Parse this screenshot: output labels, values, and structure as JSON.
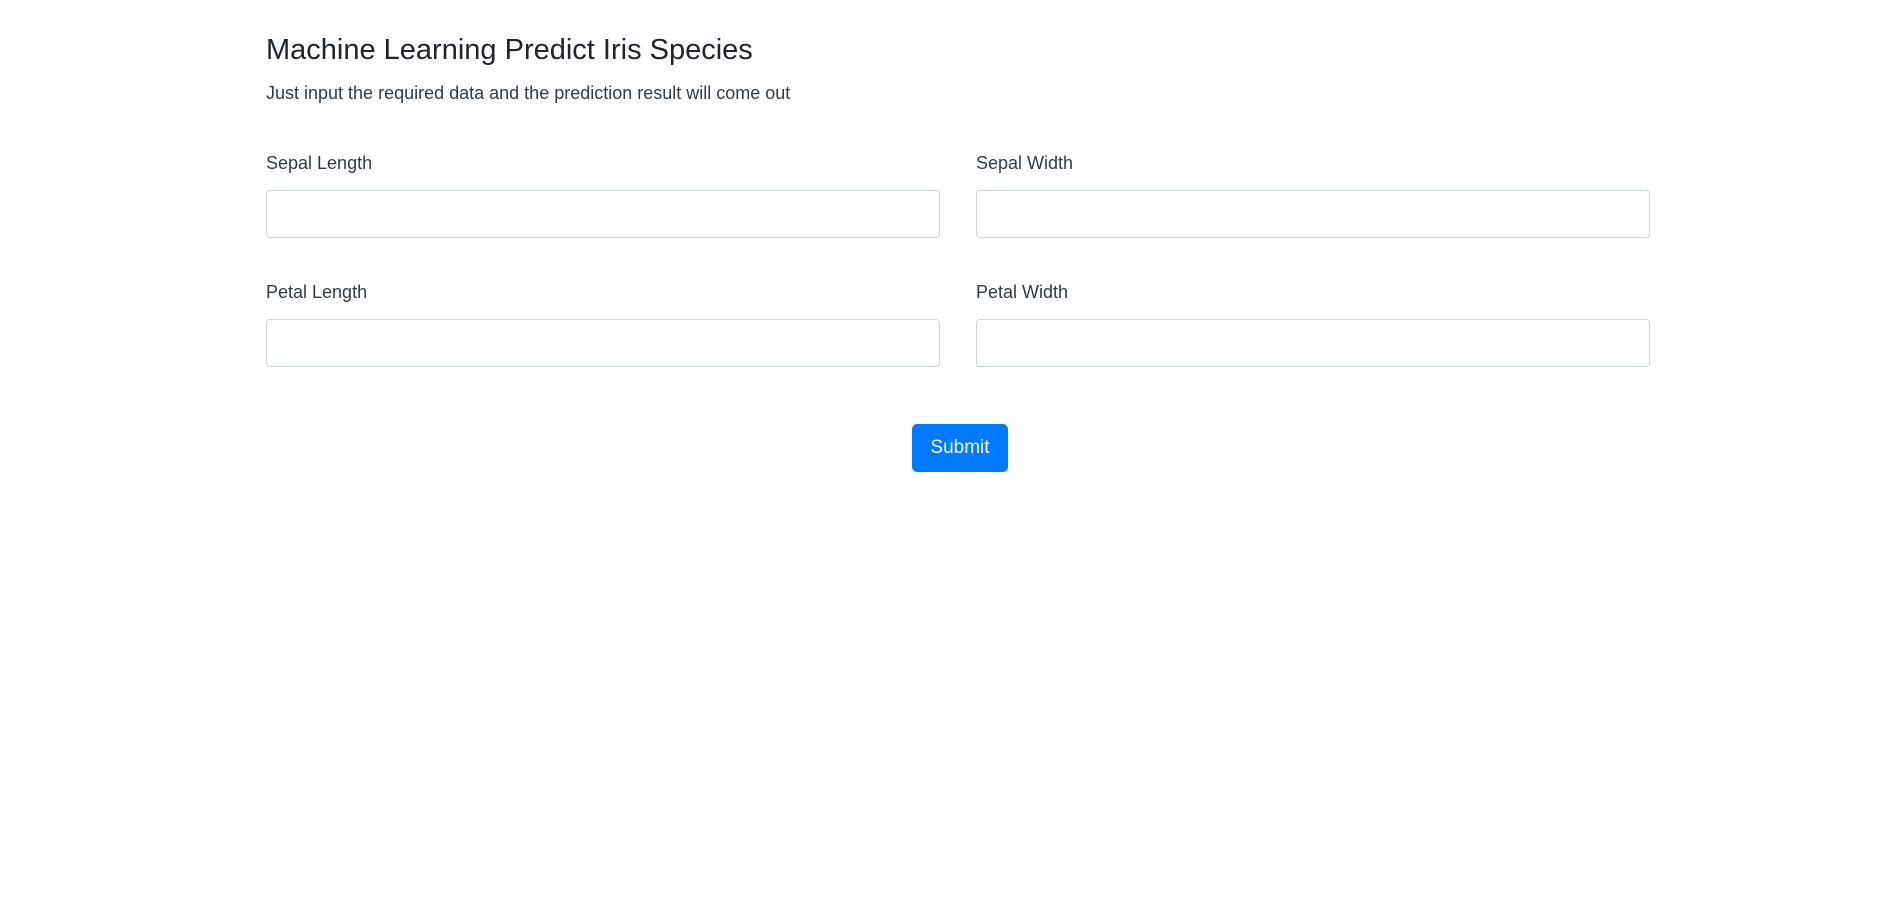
{
  "header": {
    "title": "Machine Learning Predict Iris Species",
    "subtitle": "Just input the required data and the prediction result will come out"
  },
  "form": {
    "fields": [
      {
        "label": "Sepal Length",
        "value": "",
        "placeholder": ""
      },
      {
        "label": "Sepal Width",
        "value": "",
        "placeholder": ""
      },
      {
        "label": "Petal Length",
        "value": "",
        "placeholder": ""
      },
      {
        "label": "Petal Width",
        "value": "",
        "placeholder": ""
      }
    ],
    "submit_label": "Submit"
  },
  "colors": {
    "primary": "#007bff",
    "text": "#212529",
    "input_border": "#ced4da"
  }
}
